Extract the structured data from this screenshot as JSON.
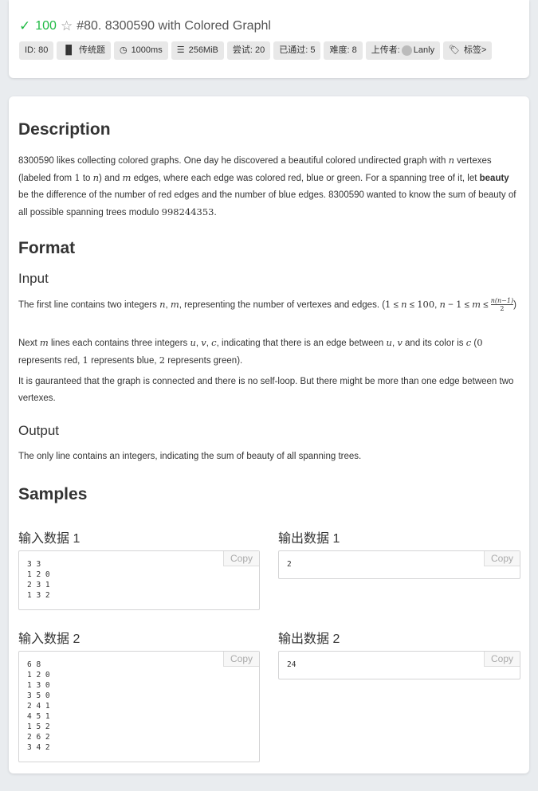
{
  "header": {
    "score": "100",
    "title": "#80. 8300590 with Colored Graphl",
    "labels": [
      {
        "icon": "id",
        "text": "ID: 80"
      },
      {
        "icon": "book-icon",
        "text": "传统题"
      },
      {
        "icon": "clock-icon",
        "text": "1000ms"
      },
      {
        "icon": "memory-icon",
        "text": "256MiB"
      },
      {
        "icon": "",
        "text": "尝试: 20"
      },
      {
        "icon": "",
        "text": "已通过: 5"
      },
      {
        "icon": "",
        "text": "难度: 8"
      },
      {
        "icon": "avatar",
        "text_prefix": "上传者:",
        "text": "Lanly"
      },
      {
        "icon": "tag-icon",
        "text": "标签>"
      }
    ]
  },
  "description": {
    "heading": "Description"
  },
  "format": {
    "heading": "Format",
    "input_heading": "Input",
    "output_heading": "Output",
    "output_text": "The only line contains an integers, indicating the sum of beauty of all spanning trees."
  },
  "samples": {
    "heading": "Samples",
    "copy_label": "Copy",
    "items": [
      {
        "input_label": "输入数据 1",
        "input": "3 3\n1 2 0\n2 3 1\n1 3 2",
        "output_label": "输出数据 1",
        "output": "2"
      },
      {
        "input_label": "输入数据 2",
        "input": "6 8\n1 2 0\n1 3 0\n3 5 0\n2 4 1\n4 5 1\n1 5 2\n2 6 2\n3 4 2",
        "output_label": "输出数据 2",
        "output": "24"
      }
    ]
  }
}
